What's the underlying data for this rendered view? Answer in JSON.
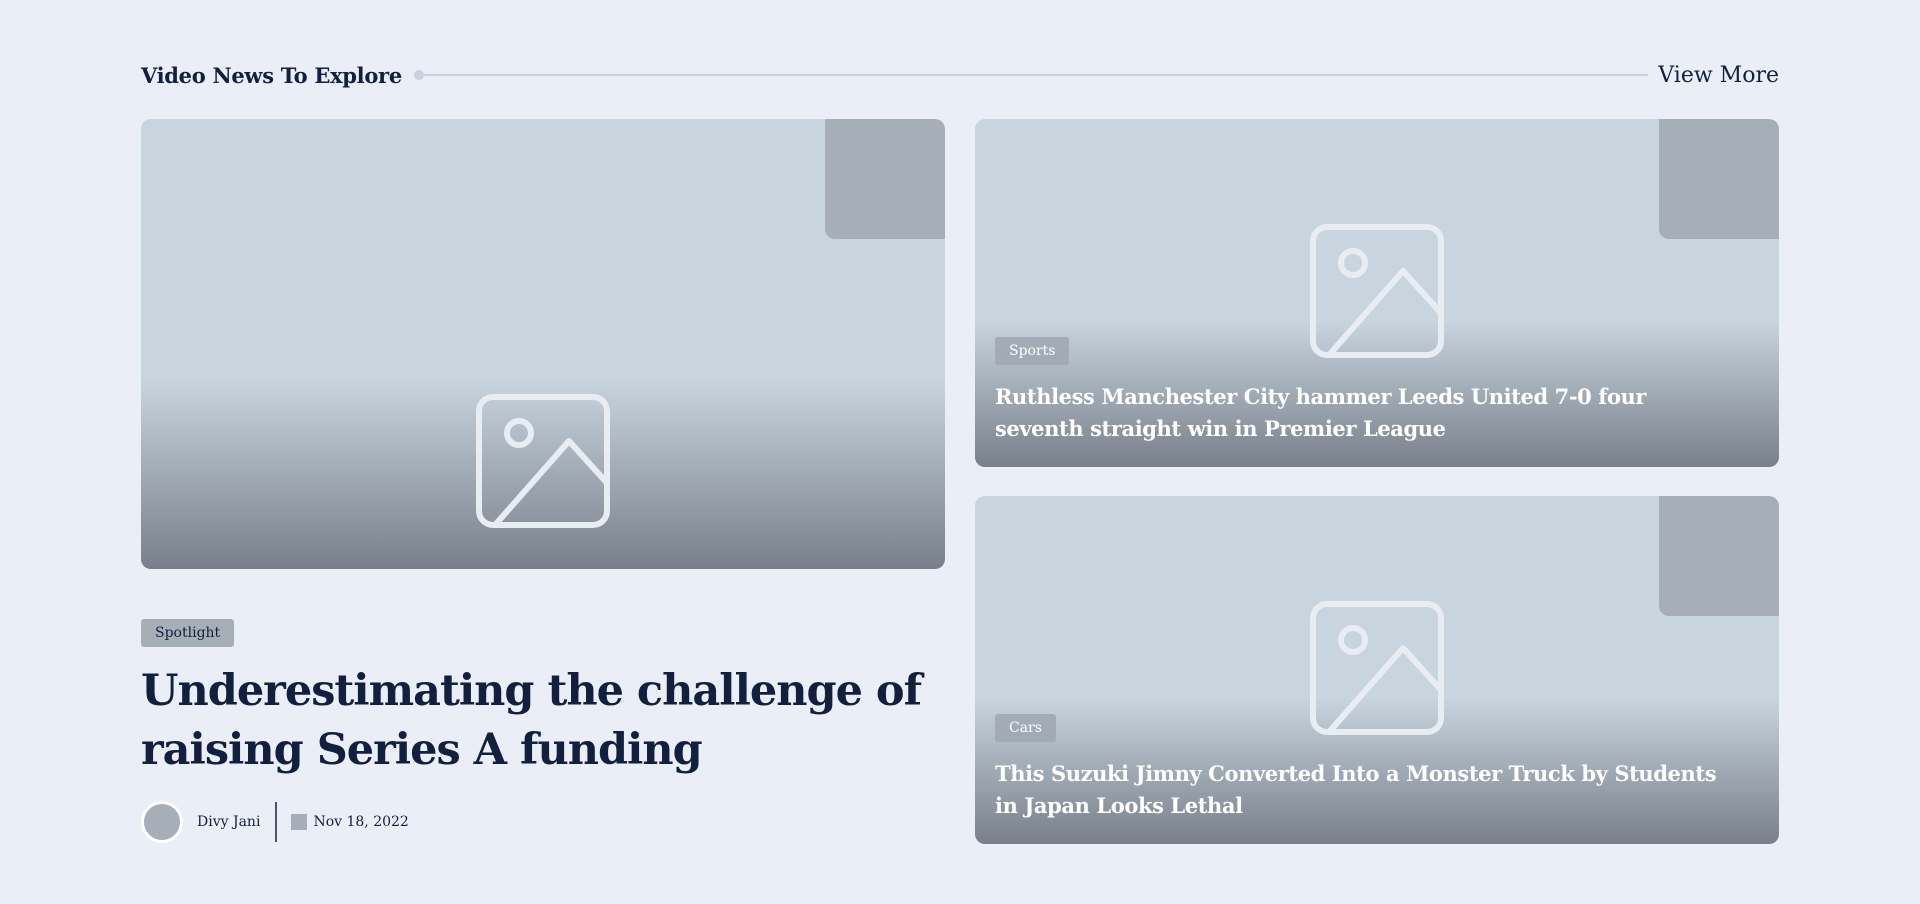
{
  "section": {
    "title": "Video News To Explore",
    "view_more_label": "View More"
  },
  "hero": {
    "image_icon": "image-placeholder-icon",
    "badge": "Spotlight",
    "title": "Underestimating the challenge of raising Series A funding",
    "author": "Divy Jani",
    "date": "Nov 18, 2022"
  },
  "cards": [
    {
      "image_icon": "image-placeholder-icon",
      "badge": "Sports",
      "title": "Ruthless Manchester City hammer Leeds United 7-0 four seventh straight win in Premier League"
    },
    {
      "image_icon": "image-placeholder-icon",
      "badge": "Cars",
      "title": "This Suzuki Jimny Converted Into a Monster Truck by Students in Japan Looks Lethal"
    }
  ],
  "colors": {
    "background": "#eaeff7",
    "text_primary": "#121f3d",
    "placeholder": "#c8d4de",
    "badge_gray": "#a6afb8"
  }
}
